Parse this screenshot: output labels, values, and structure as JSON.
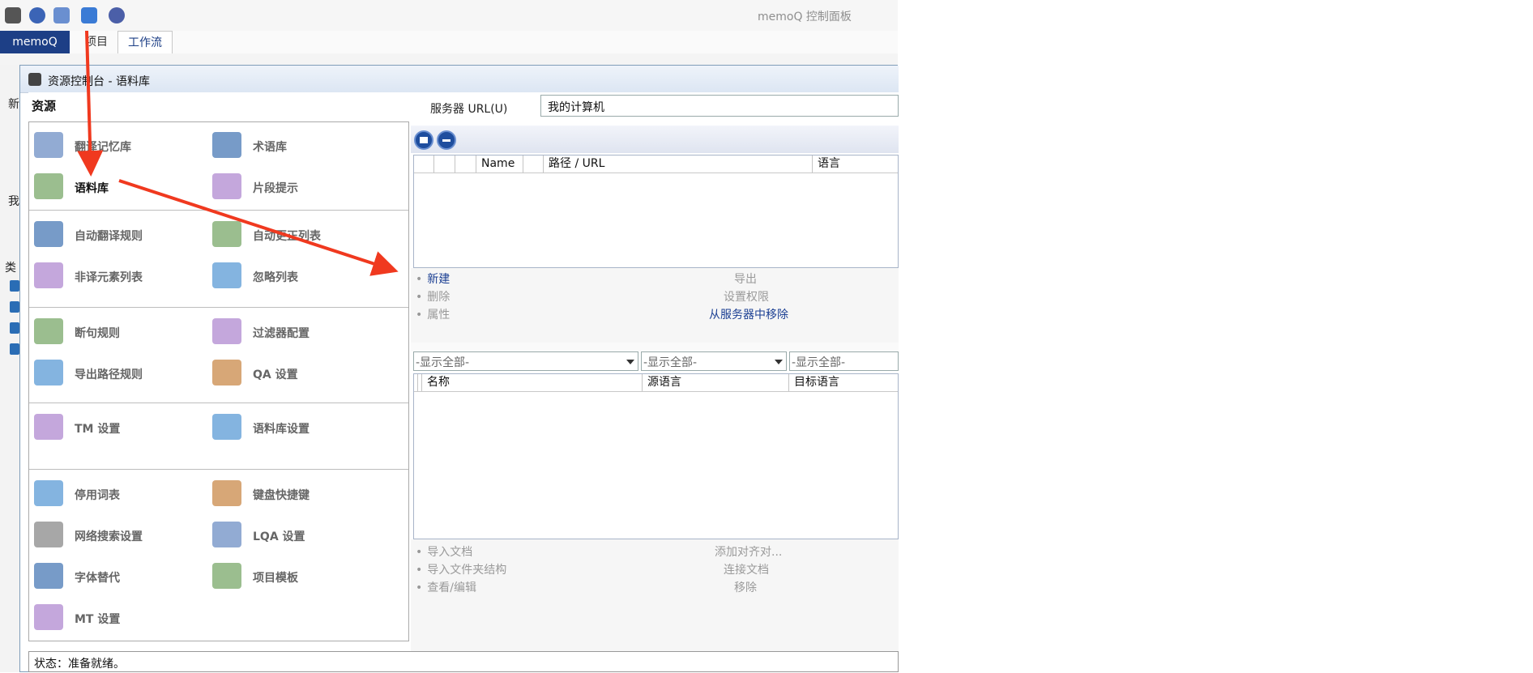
{
  "app": {
    "title": "memoQ 控制面板",
    "quick_access_icons": [
      "memoq-logo-icon",
      "help-icon",
      "network-icon",
      "database-icon",
      "settings-gear-icon"
    ],
    "ribbon_tabs": [
      "memoQ",
      "项目",
      "工作流"
    ]
  },
  "left_strip": {
    "texts": [
      "新",
      "我",
      "类"
    ]
  },
  "dialog": {
    "title": "资源控制台 - 语料库",
    "resources_header": "资源",
    "groups": [
      [
        {
          "label": "翻译记忆库",
          "icon": "translation-memory-icon",
          "active": false
        },
        {
          "label": "术语库",
          "icon": "termbase-icon",
          "active": false
        },
        {
          "label": "语料库",
          "icon": "livedocs-corpus-icon",
          "active": true
        },
        {
          "label": "片段提示",
          "icon": "muses-icon",
          "active": false
        }
      ],
      [
        {
          "label": "自动翻译规则",
          "icon": "autotranslation-rules-icon",
          "active": false
        },
        {
          "label": "自动更正列表",
          "icon": "autocorrect-icon",
          "active": false
        },
        {
          "label": "非译元素列表",
          "icon": "non-translatable-icon",
          "active": false
        },
        {
          "label": "忽略列表",
          "icon": "ignore-list-icon",
          "active": false
        }
      ],
      [
        {
          "label": "断句规则",
          "icon": "segmentation-rules-icon",
          "active": false
        },
        {
          "label": "过滤器配置",
          "icon": "filter-config-icon",
          "active": false
        },
        {
          "label": "导出路径规则",
          "icon": "export-path-icon",
          "active": false
        },
        {
          "label": "QA 设置",
          "icon": "qa-settings-icon",
          "active": false
        }
      ],
      [
        {
          "label": "TM 设置",
          "icon": "tm-settings-icon",
          "active": false
        },
        {
          "label": "语料库设置",
          "icon": "corpus-settings-icon",
          "active": false
        }
      ],
      [
        {
          "label": "停用词表",
          "icon": "stop-words-icon",
          "active": false
        },
        {
          "label": "键盘快捷键",
          "icon": "keyboard-icon",
          "active": false
        },
        {
          "label": "网络搜索设置",
          "icon": "web-search-icon",
          "active": false
        },
        {
          "label": "LQA 设置",
          "icon": "lqa-settings-icon",
          "active": false
        },
        {
          "label": "字体替代",
          "icon": "font-substitution-icon",
          "active": false
        },
        {
          "label": "项目模板",
          "icon": "project-template-icon",
          "active": false
        },
        {
          "label": "MT 设置",
          "icon": "mt-settings-icon",
          "active": false
        }
      ]
    ],
    "server_label": "服务器 URL(U)",
    "server_value": "我的计算机",
    "grid1_columns": [
      "Name",
      "路径 / URL",
      "语言"
    ],
    "actions1": [
      {
        "label": "新建",
        "enabled": true
      },
      {
        "label": "删除",
        "enabled": false
      },
      {
        "label": "属性",
        "enabled": false
      },
      {
        "label": "导出",
        "enabled": false
      },
      {
        "label": "设置权限",
        "enabled": false
      },
      {
        "label": "从服务器中移除",
        "enabled": true
      }
    ],
    "filters": [
      "-显示全部-",
      "-显示全部-",
      "-显示全部-"
    ],
    "grid2_columns": [
      "名称",
      "源语言",
      "目标语言"
    ],
    "actions2": [
      {
        "label": "导入文档",
        "enabled": false
      },
      {
        "label": "导入文件夹结构",
        "enabled": false
      },
      {
        "label": "查看/编辑",
        "enabled": false
      },
      {
        "label": "添加对齐对...",
        "enabled": false
      },
      {
        "label": "连接文档",
        "enabled": false
      },
      {
        "label": "移除",
        "enabled": false
      }
    ],
    "status": "状态：准备就绪。"
  },
  "colors": {
    "accent": "#1d3f86",
    "link": "#1b3f93",
    "annotation_arrow": "#f0391f"
  }
}
